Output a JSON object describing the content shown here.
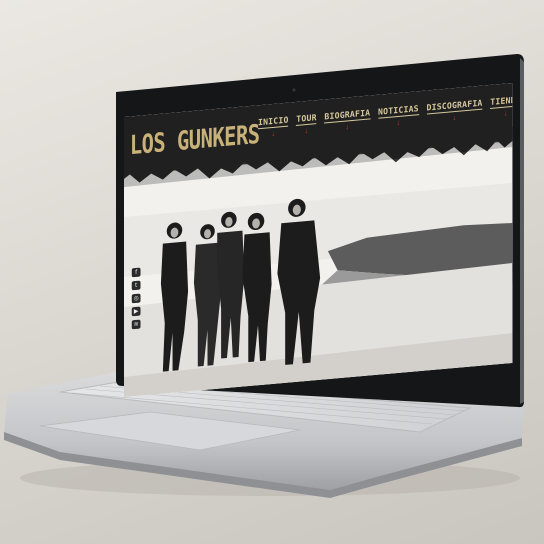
{
  "site": {
    "logo_text": "LOS GUNKERS",
    "nav": [
      {
        "label": "INICIO"
      },
      {
        "label": "TOUR"
      },
      {
        "label": "BIOGRAFIA"
      },
      {
        "label": "NOTICIAS"
      },
      {
        "label": "DISCOGRAFIA"
      },
      {
        "label": "TIENDA"
      }
    ],
    "nav_arrow_glyph": "↓",
    "social": [
      {
        "icon": "facebook-icon",
        "glyph": "f"
      },
      {
        "icon": "twitter-icon",
        "glyph": "t"
      },
      {
        "icon": "instagram-icon",
        "glyph": "◎"
      },
      {
        "icon": "youtube-icon",
        "glyph": "▶"
      },
      {
        "icon": "spotify-icon",
        "glyph": "≋"
      }
    ],
    "colors": {
      "header_bg": "#202020",
      "logo": "#c9b27a",
      "nav_text": "#d6c79b",
      "nav_arrow": "#b0392e"
    }
  }
}
